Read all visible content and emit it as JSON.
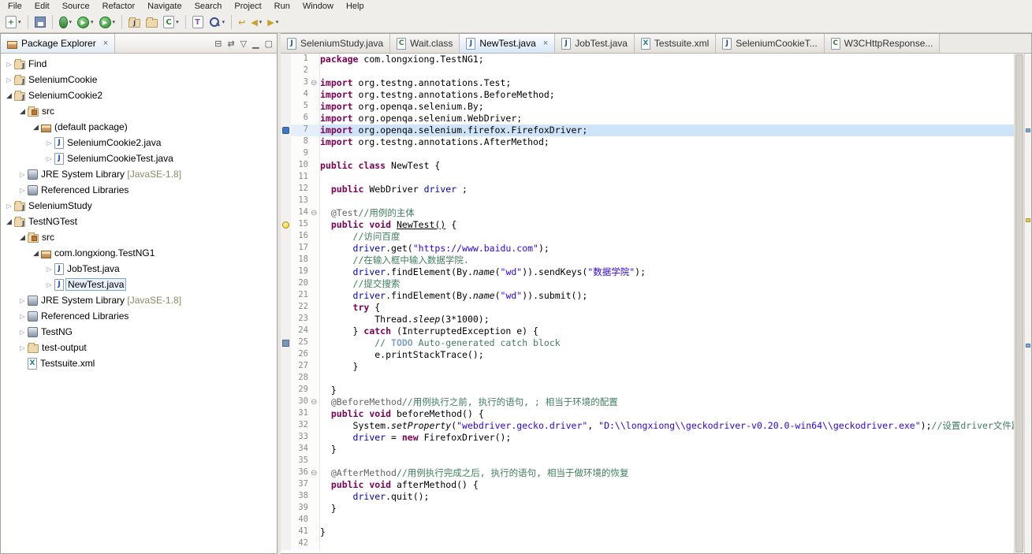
{
  "menu": {
    "items": [
      "File",
      "Edit",
      "Source",
      "Refactor",
      "Navigate",
      "Search",
      "Project",
      "Run",
      "Window",
      "Help"
    ]
  },
  "toolbar": {
    "groups": [
      [
        {
          "name": "new-wizard",
          "kind": "doc",
          "glyph": "+",
          "fg": "#2e8b2e",
          "drop": true
        }
      ],
      [
        {
          "name": "save",
          "kind": "save"
        }
      ],
      [
        {
          "name": "debug",
          "kind": "debug",
          "drop": true
        },
        {
          "name": "run",
          "kind": "run",
          "glyph": "▶",
          "drop": true
        },
        {
          "name": "external-tools",
          "kind": "run",
          "glyph": "▶",
          "drop": true
        }
      ],
      [
        {
          "name": "new-java-project",
          "kind": "folder",
          "glyph": "J",
          "fg": "#23417a"
        },
        {
          "name": "new-package",
          "kind": "folder"
        },
        {
          "name": "new-class",
          "kind": "doc",
          "glyph": "C",
          "fg": "#2e8b2e",
          "drop": true
        }
      ],
      [
        {
          "name": "open-type",
          "kind": "doc",
          "glyph": "T",
          "fg": "#7a5ca8"
        },
        {
          "name": "search",
          "kind": "search",
          "drop": true
        }
      ],
      [
        {
          "name": "last-edit-location",
          "kind": "arrow",
          "glyph": "↩",
          "fg": "#c9a227"
        },
        {
          "name": "back",
          "kind": "arrow",
          "glyph": "◀",
          "fg": "#c9a227",
          "drop": true
        },
        {
          "name": "forward",
          "kind": "arrow",
          "glyph": "▶",
          "fg": "#c9a227",
          "drop": true
        }
      ]
    ]
  },
  "package_explorer": {
    "title": "Package Explorer",
    "close_glyph": "×",
    "tools": [
      {
        "name": "collapse-all",
        "glyph": "⊟"
      },
      {
        "name": "link-with-editor",
        "glyph": "⇄"
      },
      {
        "name": "view-menu",
        "glyph": "▽"
      },
      {
        "name": "minimize",
        "glyph": "▁"
      },
      {
        "name": "maximize",
        "glyph": "▢"
      }
    ],
    "tree": [
      {
        "depth": 0,
        "arrow": "c",
        "icon": "project",
        "label": "Find"
      },
      {
        "depth": 0,
        "arrow": "c",
        "icon": "project",
        "label": "SeleniumCookie"
      },
      {
        "depth": 0,
        "arrow": "e",
        "icon": "project",
        "label": "SeleniumCookie2"
      },
      {
        "depth": 1,
        "arrow": "e",
        "icon": "src",
        "label": "src"
      },
      {
        "depth": 2,
        "arrow": "e",
        "icon": "pkg",
        "label": "(default package)"
      },
      {
        "depth": 3,
        "arrow": "c",
        "icon": "jfile",
        "label": "SeleniumCookie2.java"
      },
      {
        "depth": 3,
        "arrow": "c",
        "icon": "jfile",
        "label": "SeleniumCookieTest.java"
      },
      {
        "depth": 1,
        "arrow": "c",
        "icon": "lib",
        "label": "JRE System Library",
        "suffix": " [JavaSE-1.8]"
      },
      {
        "depth": 1,
        "arrow": "c",
        "icon": "lib",
        "label": "Referenced Libraries"
      },
      {
        "depth": 0,
        "arrow": "c",
        "icon": "project",
        "label": "SeleniumStudy"
      },
      {
        "depth": 0,
        "arrow": "e",
        "icon": "project",
        "label": "TestNGTest"
      },
      {
        "depth": 1,
        "arrow": "e",
        "icon": "src",
        "label": "src"
      },
      {
        "depth": 2,
        "arrow": "e",
        "icon": "pkg",
        "label": "com.longxiong.TestNG1"
      },
      {
        "depth": 3,
        "arrow": "c",
        "icon": "jfile",
        "label": "JobTest.java"
      },
      {
        "depth": 3,
        "arrow": "c",
        "icon": "jfile",
        "label": "NewTest.java",
        "selected": true
      },
      {
        "depth": 1,
        "arrow": "c",
        "icon": "lib",
        "label": "JRE System Library",
        "suffix": " [JavaSE-1.8]"
      },
      {
        "depth": 1,
        "arrow": "c",
        "icon": "lib",
        "label": "Referenced Libraries"
      },
      {
        "depth": 1,
        "arrow": "c",
        "icon": "lib",
        "label": "TestNG"
      },
      {
        "depth": 1,
        "arrow": "c",
        "icon": "folder",
        "label": "test-output"
      },
      {
        "depth": 1,
        "arrow": "n",
        "icon": "xfile",
        "label": "Testsuite.xml"
      }
    ]
  },
  "editor": {
    "tabs": [
      {
        "icon": "java",
        "label": "SeleniumStudy.java"
      },
      {
        "icon": "class",
        "label": "Wait.class"
      },
      {
        "icon": "java",
        "label": "NewTest.java",
        "active": true
      },
      {
        "icon": "java",
        "label": "JobTest.java"
      },
      {
        "icon": "xml",
        "label": "Testsuite.xml"
      },
      {
        "icon": "java",
        "label": "SeleniumCookieT..."
      },
      {
        "icon": "class",
        "label": "W3CHttpResponse..."
      }
    ],
    "overview_marks": [
      {
        "top_pct": 15,
        "color": "#7da7d9"
      },
      {
        "top_pct": 33,
        "color": "#e8c84a"
      },
      {
        "top_pct": 58,
        "color": "#7da7d9"
      }
    ],
    "lines": [
      {
        "n": 1,
        "seg": [
          [
            "k",
            "package"
          ],
          [
            "d",
            " com.longxiong.TestNG1;"
          ]
        ]
      },
      {
        "n": 2,
        "seg": []
      },
      {
        "n": 3,
        "fold": true,
        "seg": [
          [
            "k",
            "import"
          ],
          [
            "d",
            " org.testng.annotations.Test;"
          ]
        ]
      },
      {
        "n": 4,
        "seg": [
          [
            "k",
            "import"
          ],
          [
            "d",
            " org.testng.annotations.BeforeMethod;"
          ]
        ]
      },
      {
        "n": 5,
        "seg": [
          [
            "k",
            "import"
          ],
          [
            "d",
            " org.openqa.selenium.By;"
          ]
        ]
      },
      {
        "n": 6,
        "seg": [
          [
            "k",
            "import"
          ],
          [
            "d",
            " org.openqa.selenium.WebDriver;"
          ]
        ]
      },
      {
        "n": 7,
        "hl": true,
        "marker": "occurrence",
        "seg": [
          [
            "k",
            "import"
          ],
          [
            "d",
            " org.openqa.selenium.firefox.FirefoxDriver;"
          ]
        ]
      },
      {
        "n": 8,
        "seg": [
          [
            "k",
            "import"
          ],
          [
            "d",
            " org.testng.annotations.AfterMethod;"
          ]
        ]
      },
      {
        "n": 9,
        "seg": []
      },
      {
        "n": 10,
        "seg": [
          [
            "k",
            "public"
          ],
          [
            "d",
            " "
          ],
          [
            "k",
            "class"
          ],
          [
            "d",
            " NewTest {"
          ]
        ]
      },
      {
        "n": 11,
        "seg": []
      },
      {
        "n": 12,
        "seg": [
          [
            "d",
            "  "
          ],
          [
            "k",
            "public"
          ],
          [
            "d",
            " WebDriver "
          ],
          [
            "f",
            "driver"
          ],
          [
            "d",
            " ;"
          ]
        ]
      },
      {
        "n": 13,
        "seg": []
      },
      {
        "n": 14,
        "fold": true,
        "seg": [
          [
            "d",
            "  "
          ],
          [
            "a",
            "@Test"
          ],
          [
            "c",
            "//用例的主体"
          ]
        ]
      },
      {
        "n": 15,
        "marker": "quickfix",
        "seg": [
          [
            "d",
            "  "
          ],
          [
            "k",
            "public"
          ],
          [
            "d",
            " "
          ],
          [
            "k",
            "void"
          ],
          [
            "d",
            " "
          ],
          [
            "u",
            "NewTest()"
          ],
          [
            "d",
            " {"
          ]
        ]
      },
      {
        "n": 16,
        "seg": [
          [
            "d",
            "      "
          ],
          [
            "c",
            "//访问百度"
          ]
        ]
      },
      {
        "n": 17,
        "seg": [
          [
            "d",
            "      "
          ],
          [
            "f",
            "driver"
          ],
          [
            "d",
            ".get("
          ],
          [
            "s",
            "\"https://www.baidu.com\""
          ],
          [
            "d",
            ");"
          ]
        ]
      },
      {
        "n": 18,
        "seg": [
          [
            "d",
            "      "
          ],
          [
            "c",
            "//在输入框中输入数据学院."
          ]
        ]
      },
      {
        "n": 19,
        "seg": [
          [
            "d",
            "      "
          ],
          [
            "f",
            "driver"
          ],
          [
            "d",
            ".findElement(By."
          ],
          [
            "i",
            "name"
          ],
          [
            "d",
            "("
          ],
          [
            "s",
            "\"wd\""
          ],
          [
            "d",
            ")).sendKeys("
          ],
          [
            "s",
            "\"数据学院\""
          ],
          [
            "d",
            ");"
          ]
        ]
      },
      {
        "n": 20,
        "seg": [
          [
            "d",
            "      "
          ],
          [
            "c",
            "//提交搜索"
          ]
        ]
      },
      {
        "n": 21,
        "seg": [
          [
            "d",
            "      "
          ],
          [
            "f",
            "driver"
          ],
          [
            "d",
            ".findElement(By."
          ],
          [
            "i",
            "name"
          ],
          [
            "d",
            "("
          ],
          [
            "s",
            "\"wd\""
          ],
          [
            "d",
            ")).submit();"
          ]
        ]
      },
      {
        "n": 22,
        "seg": [
          [
            "d",
            "      "
          ],
          [
            "k",
            "try"
          ],
          [
            "d",
            " {"
          ]
        ]
      },
      {
        "n": 23,
        "seg": [
          [
            "d",
            "          Thread."
          ],
          [
            "i",
            "sleep"
          ],
          [
            "d",
            "(3*1000);"
          ]
        ]
      },
      {
        "n": 24,
        "seg": [
          [
            "d",
            "      } "
          ],
          [
            "k",
            "catch"
          ],
          [
            "d",
            " (InterruptedException e) {"
          ]
        ]
      },
      {
        "n": 25,
        "marker": "task",
        "seg": [
          [
            "d",
            "          "
          ],
          [
            "c",
            "// "
          ],
          [
            "t",
            "TODO"
          ],
          [
            "c",
            " Auto-generated catch block"
          ]
        ]
      },
      {
        "n": 26,
        "seg": [
          [
            "d",
            "          e.printStackTrace();"
          ]
        ]
      },
      {
        "n": 27,
        "seg": [
          [
            "d",
            "      }"
          ]
        ]
      },
      {
        "n": 28,
        "seg": []
      },
      {
        "n": 29,
        "seg": [
          [
            "d",
            "  }"
          ]
        ]
      },
      {
        "n": 30,
        "fold": true,
        "seg": [
          [
            "d",
            "  "
          ],
          [
            "a",
            "@BeforeMethod"
          ],
          [
            "c",
            "//用例执行之前, 执行的语句, ; 相当于环境的配置"
          ]
        ]
      },
      {
        "n": 31,
        "seg": [
          [
            "d",
            "  "
          ],
          [
            "k",
            "public"
          ],
          [
            "d",
            " "
          ],
          [
            "k",
            "void"
          ],
          [
            "d",
            " beforeMethod() {"
          ]
        ]
      },
      {
        "n": 32,
        "seg": [
          [
            "d",
            "      System."
          ],
          [
            "i",
            "setProperty"
          ],
          [
            "d",
            "("
          ],
          [
            "s",
            "\"webdriver.gecko.driver\""
          ],
          [
            "d",
            ", "
          ],
          [
            "s",
            "\"D:\\\\longxiong\\\\geckodriver-v0.20.0-win64\\\\geckodriver.exe\""
          ],
          [
            "d",
            ");"
          ],
          [
            "c",
            "//设置driver文件路径"
          ]
        ]
      },
      {
        "n": 33,
        "seg": [
          [
            "d",
            "      "
          ],
          [
            "f",
            "driver"
          ],
          [
            "d",
            " = "
          ],
          [
            "k",
            "new"
          ],
          [
            "d",
            " FirefoxDriver();"
          ]
        ]
      },
      {
        "n": 34,
        "seg": [
          [
            "d",
            "  }"
          ]
        ]
      },
      {
        "n": 35,
        "seg": []
      },
      {
        "n": 36,
        "fold": true,
        "seg": [
          [
            "d",
            "  "
          ],
          [
            "a",
            "@AfterMethod"
          ],
          [
            "c",
            "//用例执行完成之后, 执行的语句, 相当于做环境的恢复"
          ]
        ]
      },
      {
        "n": 37,
        "seg": [
          [
            "d",
            "  "
          ],
          [
            "k",
            "public"
          ],
          [
            "d",
            " "
          ],
          [
            "k",
            "void"
          ],
          [
            "d",
            " afterMethod() {"
          ]
        ]
      },
      {
        "n": 38,
        "seg": [
          [
            "d",
            "      "
          ],
          [
            "f",
            "driver"
          ],
          [
            "d",
            ".quit();"
          ]
        ]
      },
      {
        "n": 39,
        "seg": [
          [
            "d",
            "  }"
          ]
        ]
      },
      {
        "n": 40,
        "seg": []
      },
      {
        "n": 41,
        "seg": [
          [
            "d",
            "}"
          ]
        ]
      },
      {
        "n": 42,
        "seg": []
      }
    ]
  },
  "colors": {
    "keyword": "#7f0055",
    "string": "#2a00ff",
    "comment": "#3f7f5f",
    "field": "#0000c0",
    "annotation": "#646464",
    "task_tag": "#7f9fbf",
    "line_highlight": "#cfe4f8",
    "selection_border": "#7ba7d7"
  }
}
